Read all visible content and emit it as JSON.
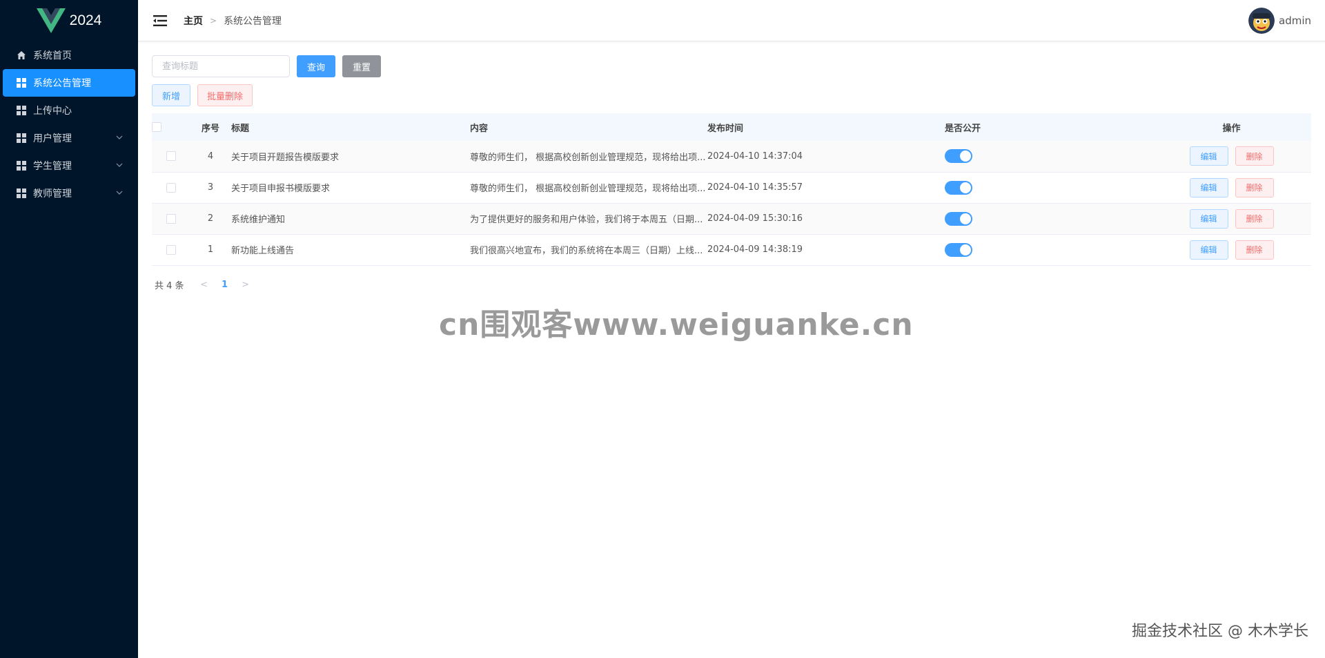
{
  "logo": {
    "text": "2024"
  },
  "sidebar": {
    "items": [
      {
        "label": "系统首页",
        "icon": "home-icon",
        "active": false,
        "expandable": false
      },
      {
        "label": "系统公告管理",
        "icon": "grid-icon",
        "active": true,
        "expandable": false
      },
      {
        "label": "上传中心",
        "icon": "grid-icon",
        "active": false,
        "expandable": false
      },
      {
        "label": "用户管理",
        "icon": "grid-icon",
        "active": false,
        "expandable": true
      },
      {
        "label": "学生管理",
        "icon": "grid-icon",
        "active": false,
        "expandable": true
      },
      {
        "label": "教师管理",
        "icon": "grid-icon",
        "active": false,
        "expandable": true
      }
    ]
  },
  "header": {
    "breadcrumb_home": "主页",
    "breadcrumb_sep": ">",
    "breadcrumb_current": "系统公告管理",
    "username": "admin"
  },
  "search": {
    "placeholder": "查询标题",
    "value": "",
    "query_label": "查询",
    "reset_label": "重置"
  },
  "actions": {
    "add_label": "新增",
    "batch_delete_label": "批量删除"
  },
  "table": {
    "columns": [
      "序号",
      "标题",
      "内容",
      "发布时间",
      "是否公开",
      "操作"
    ],
    "rows": [
      {
        "index": "4",
        "title": "关于项目开题报告模版要求",
        "content": "尊敬的师生们， 根据高校创新创业管理规范，现将给出项...",
        "time": "2024-04-10 14:37:04",
        "public": true
      },
      {
        "index": "3",
        "title": "关于项目申报书模版要求",
        "content": "尊敬的师生们， 根据高校创新创业管理规范，现将给出项...",
        "time": "2024-04-10 14:35:57",
        "public": true
      },
      {
        "index": "2",
        "title": "系统维护通知",
        "content": "为了提供更好的服务和用户体验，我们将于本周五（日期...",
        "time": "2024-04-09 15:30:16",
        "public": true
      },
      {
        "index": "1",
        "title": "新功能上线通告",
        "content": "我们很高兴地宣布，我们的系统将在本周三（日期）上线...",
        "time": "2024-04-09 14:38:19",
        "public": true
      }
    ],
    "edit_label": "编辑",
    "delete_label": "删除"
  },
  "pagination": {
    "total_label": "共 4 条",
    "prev": "<",
    "current_page": "1",
    "next": ">"
  },
  "watermarks": {
    "center": "cn围观客www.weiguanke.cn",
    "corner": "掘金技术社区 @ 木木学长"
  },
  "colors": {
    "sidebar_bg": "#001529",
    "active_menu": "#1890ff",
    "primary": "#409eff",
    "danger": "#f56c6c",
    "header_row_bg": "#f2f8fd"
  }
}
